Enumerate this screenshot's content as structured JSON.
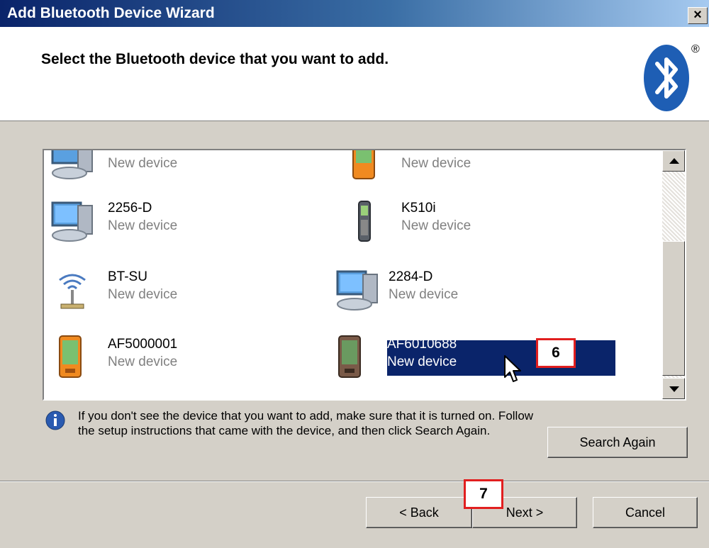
{
  "window": {
    "title": "Add Bluetooth Device Wizard",
    "close_label": "×"
  },
  "header": {
    "instruction": "Select the Bluetooth device that you want to add.",
    "registered_mark": "®"
  },
  "devices": [
    {
      "name": "",
      "status": "New device",
      "icon": "computer-icon"
    },
    {
      "name": "",
      "status": "New device",
      "icon": "pda-icon"
    },
    {
      "name": "2256-D",
      "status": "New device",
      "icon": "computer-icon"
    },
    {
      "name": "K510i",
      "status": "New device",
      "icon": "phone-icon"
    },
    {
      "name": "BT-SU",
      "status": "New device",
      "icon": "wireless-antenna-icon"
    },
    {
      "name": "2284-D",
      "status": "New device",
      "icon": "computer-icon"
    },
    {
      "name": "AF5000001",
      "status": "New device",
      "icon": "pda-icon"
    },
    {
      "name": "AF6010688",
      "status": "New device",
      "icon": "pda-icon",
      "selected": true
    }
  ],
  "info": {
    "text": "If you don't see the device that you want to add, make sure that it is turned on. Follow the setup instructions that came with the device, and then click Search Again."
  },
  "buttons": {
    "search_again": "Search Again",
    "back": "< Back",
    "next": "Next >",
    "cancel": "Cancel"
  },
  "annotations": {
    "step6": "6",
    "step7": "7"
  },
  "colors": {
    "selection": "#0a246a",
    "annotation_border": "#e11f1f",
    "bluetooth": "#1e5eb4"
  }
}
